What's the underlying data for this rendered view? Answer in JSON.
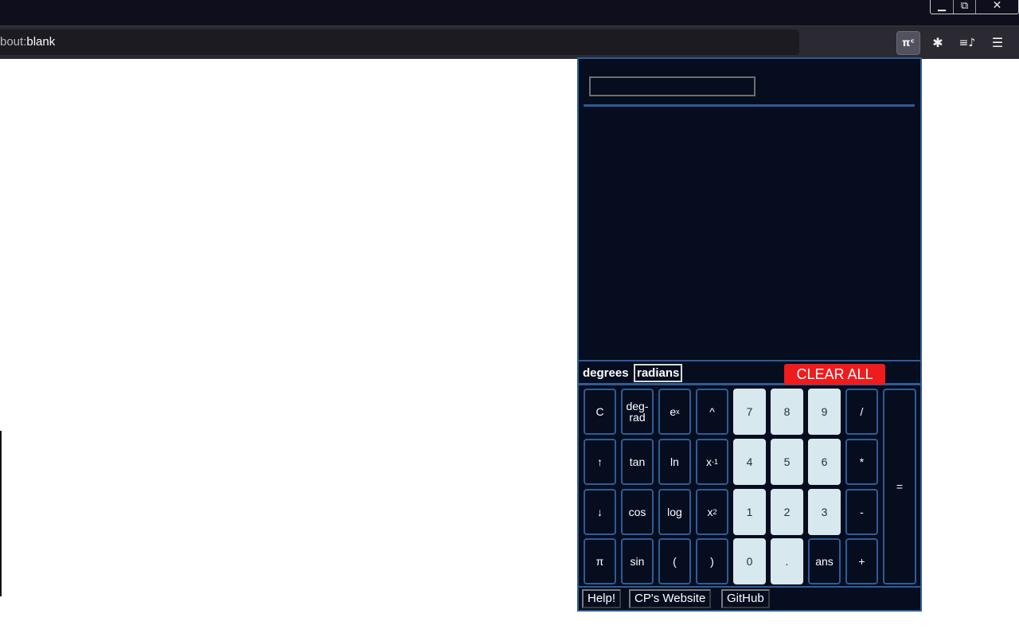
{
  "window": {
    "controls": {
      "minimize": "▁",
      "restore": "⧉",
      "close": "✕"
    }
  },
  "browser": {
    "url_prefix": "bout:",
    "url_main": "blank",
    "toolbar": {
      "extension_label": "πᶜ",
      "extensions_icon": "puzzle-icon",
      "extensions_glyph": "✱",
      "playlist_glyph": "≡♪",
      "menu_glyph": "☰"
    }
  },
  "calculator": {
    "input_value": "",
    "mode": {
      "degrees": "degrees",
      "radians": "radians",
      "selected": "radians"
    },
    "clear_all": "CLEAR ALL",
    "keys": [
      [
        "C",
        "deg-\nrad",
        "e^x",
        "^",
        "7",
        "8",
        "9",
        "/"
      ],
      [
        "↑",
        "tan",
        "ln",
        "x^-1",
        "4",
        "5",
        "6",
        "*"
      ],
      [
        "↓",
        "cos",
        "log",
        "x^2",
        "1",
        "2",
        "3",
        "-"
      ],
      [
        "π",
        "sin",
        "(",
        ")",
        "0",
        ".",
        "ans",
        "+"
      ]
    ],
    "key_labels": {
      "c": "C",
      "deg1": "deg-",
      "deg2": "rad",
      "ex_base": "e",
      "ex_sup": "x",
      "pow": "^",
      "k7": "7",
      "k8": "8",
      "k9": "9",
      "div": "/",
      "up": "↑",
      "tan": "tan",
      "ln": "ln",
      "inv_base": "x",
      "inv_sup": "-1",
      "k4": "4",
      "k5": "5",
      "k6": "6",
      "mul": "*",
      "down": "↓",
      "cos": "cos",
      "log": "log",
      "sq_base": "x",
      "sq_sup": "2",
      "k1": "1",
      "k2": "2",
      "k3": "3",
      "sub": "-",
      "pi": "π",
      "sin": "sin",
      "lparen": "(",
      "rparen": ")",
      "k0": "0",
      "dot": ".",
      "ans": "ans",
      "add": "+",
      "eq": "="
    },
    "footer": {
      "help": "Help!",
      "website": "CP's Website",
      "github": "GitHub"
    },
    "colors": {
      "background": "#050d1f",
      "accent": "#2e5c96",
      "number_key": "#d8e8ef",
      "clear": "#ee1c1c"
    }
  }
}
